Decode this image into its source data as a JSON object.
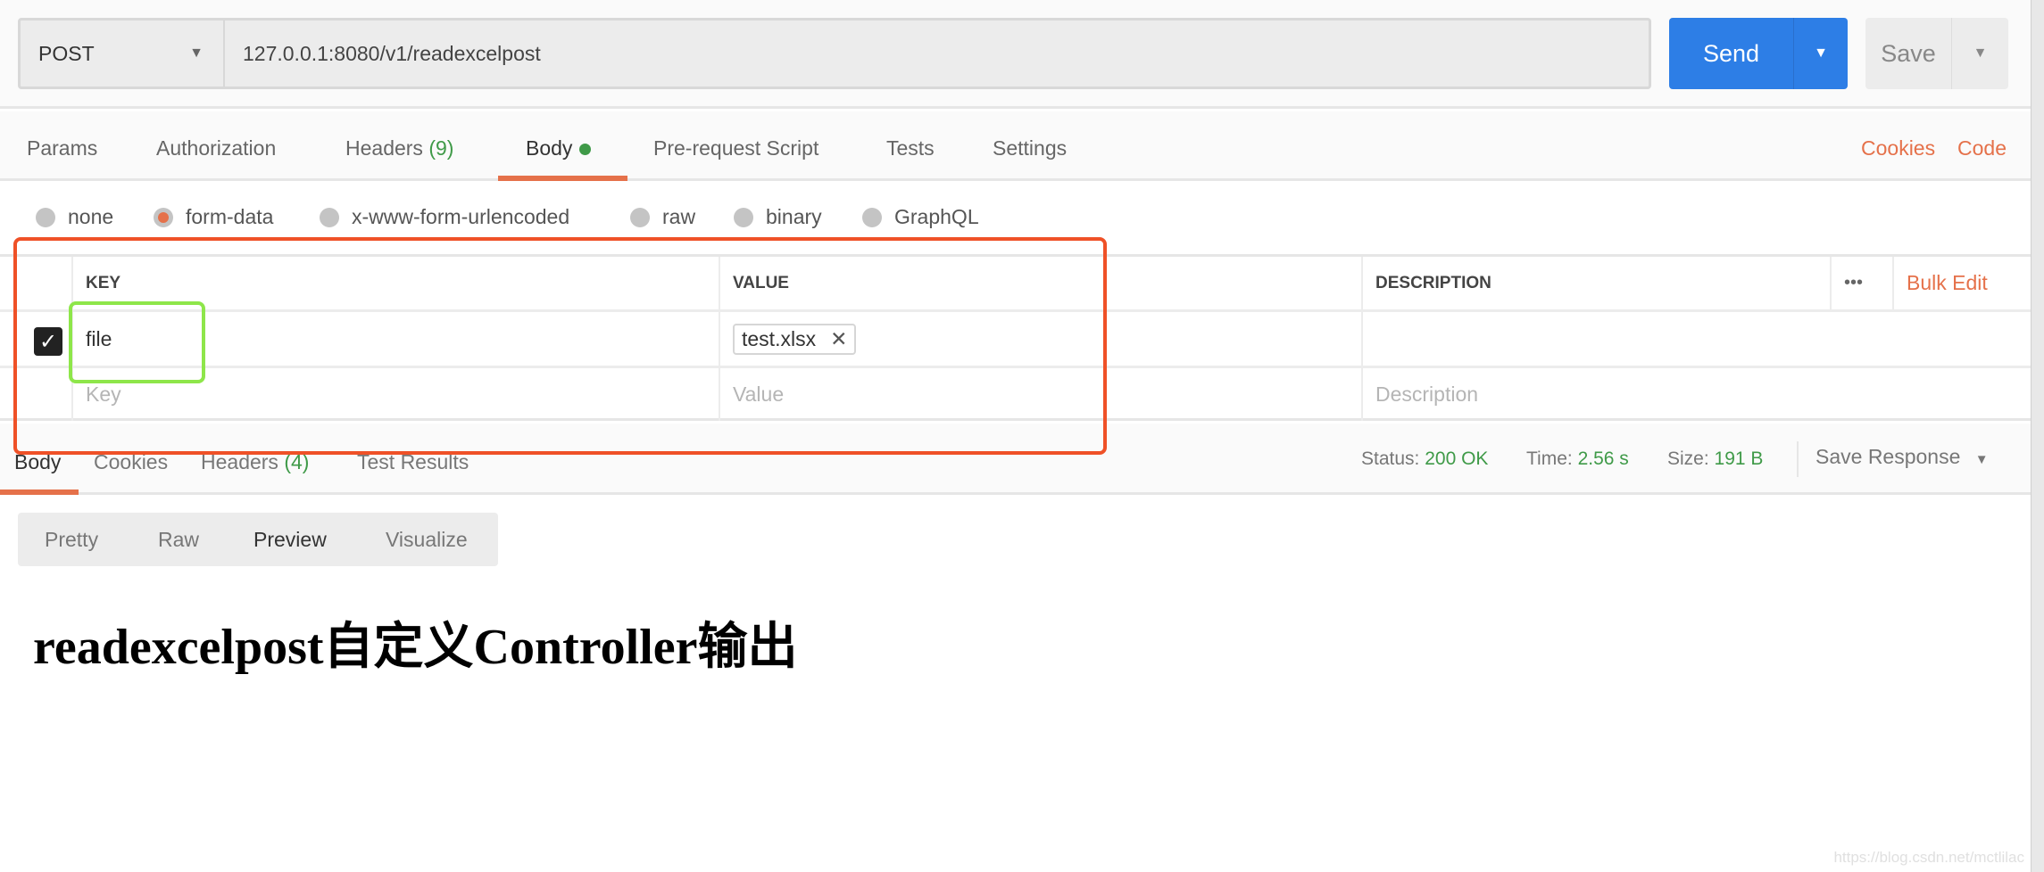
{
  "request": {
    "method": "POST",
    "url": "127.0.0.1:8080/v1/readexcelpost",
    "send_label": "Send",
    "save_label": "Save"
  },
  "tabs": [
    {
      "label": "Params"
    },
    {
      "label": "Authorization"
    },
    {
      "label": "Headers",
      "count": "(9)"
    },
    {
      "label": "Body",
      "active": true
    },
    {
      "label": "Pre-request Script"
    },
    {
      "label": "Tests"
    },
    {
      "label": "Settings"
    }
  ],
  "links": {
    "cookies": "Cookies",
    "code": "Code"
  },
  "body_types": [
    {
      "label": "none"
    },
    {
      "label": "form-data",
      "selected": true
    },
    {
      "label": "x-www-form-urlencoded"
    },
    {
      "label": "raw"
    },
    {
      "label": "binary"
    },
    {
      "label": "GraphQL"
    }
  ],
  "table": {
    "headers": {
      "key": "KEY",
      "value": "VALUE",
      "description": "DESCRIPTION"
    },
    "more_icon": "•••",
    "bulk_edit": "Bulk Edit",
    "rows": [
      {
        "checked": true,
        "key": "file",
        "value": "test.xlsx",
        "description": ""
      }
    ],
    "placeholders": {
      "key": "Key",
      "value": "Value",
      "description": "Description"
    }
  },
  "response": {
    "tabs": [
      {
        "label": "Body",
        "active": true
      },
      {
        "label": "Cookies"
      },
      {
        "label": "Headers",
        "count": "(4)"
      },
      {
        "label": "Test Results"
      }
    ],
    "status_label": "Status:",
    "status": "200 OK",
    "time_label": "Time:",
    "time": "2.56 s",
    "size_label": "Size:",
    "size": "191 B",
    "save_response": "Save Response",
    "views": [
      "Pretty",
      "Raw",
      "Preview",
      "Visualize"
    ],
    "active_view": "Preview",
    "preview_heading": "readexcelpost自定义Controller输出"
  },
  "watermark": "https://blog.csdn.net/mctlilac",
  "colors": {
    "accent": "#e5714a",
    "send": "#2d7ee6",
    "success": "#3f9a48",
    "annotation_red": "#ef5127",
    "annotation_green": "#8ee64a"
  }
}
